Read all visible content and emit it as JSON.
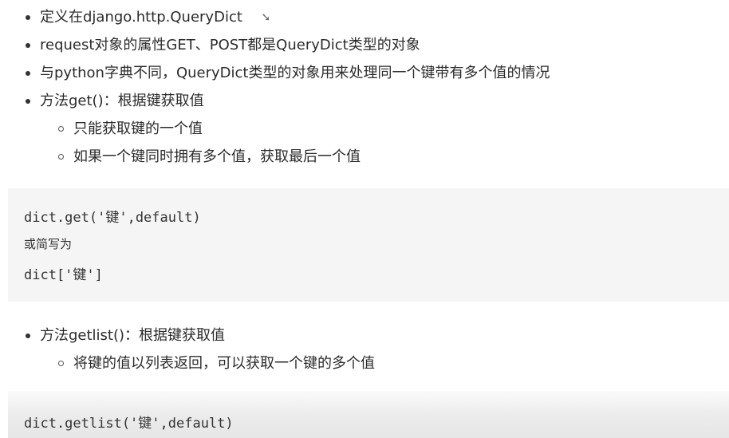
{
  "list1": {
    "items": [
      {
        "text": "定义在django.http.QueryDict"
      },
      {
        "text": "request对象的属性GET、POST都是QueryDict类型的对象"
      },
      {
        "text": "与python字典不同，QueryDict类型的对象用来处理同一个键带有多个值的情况"
      },
      {
        "text": "方法get()：根据键获取值"
      }
    ],
    "subitems": [
      {
        "text": "只能获取键的一个值"
      },
      {
        "text": "如果一个键同时拥有多个值，获取最后一个值"
      }
    ]
  },
  "code1": {
    "lines": [
      "dict.get('键',default)",
      "或简写为",
      "dict['键']"
    ]
  },
  "list2": {
    "items": [
      {
        "text": "方法getlist()：根据键获取值"
      }
    ],
    "subitems": [
      {
        "text": "将键的值以列表返回，可以获取一个键的多个值"
      }
    ]
  },
  "code2": {
    "lines": [
      "dict.getlist('键',default)"
    ]
  },
  "icons": {
    "cursor": "mouse-cursor-icon"
  }
}
